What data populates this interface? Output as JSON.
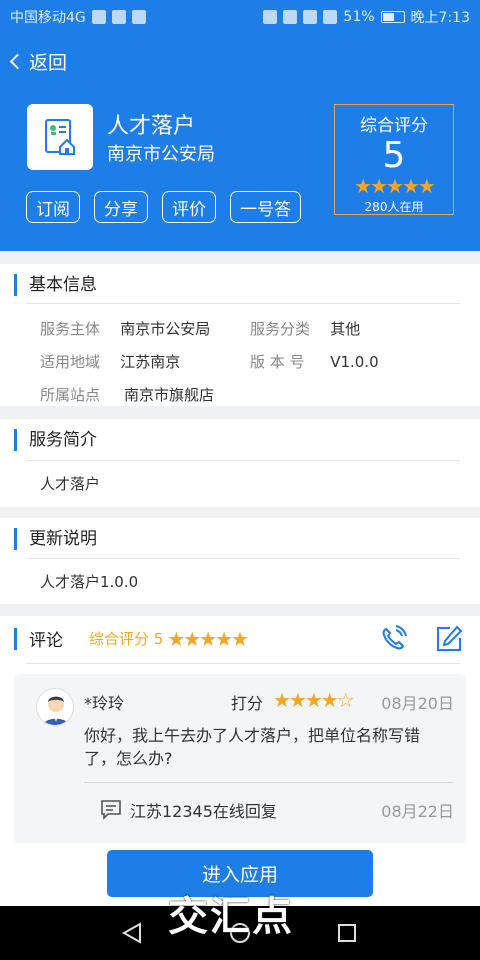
{
  "status_bar": {
    "carrier": "中国移动4G",
    "battery": "51%",
    "time": "晚上7:13"
  },
  "header": {
    "back_label": "返回",
    "app_name": "人才落户",
    "provider": "南京市公安局",
    "score_label": "综合评分",
    "score_value": "5",
    "score_stars": "★★★★★",
    "users": "280人在用",
    "buttons": [
      "订阅",
      "分享",
      "评价",
      "一号答"
    ]
  },
  "basic_info": {
    "title": "基本信息",
    "rows": [
      [
        {
          "key": "服务主体",
          "value": "南京市公安局"
        },
        {
          "key": "服务分类",
          "value": "其他"
        }
      ],
      [
        {
          "key": "适用地域",
          "value": "江苏南京"
        },
        {
          "key": "版 本 号",
          "value": "V1.0.0"
        }
      ],
      [
        {
          "key": "所属站点",
          "value": "南京市旗舰店"
        }
      ]
    ]
  },
  "service_intro": {
    "title": "服务简介",
    "text": "人才落户"
  },
  "update_notes": {
    "title": "更新说明",
    "text": "人才落户1.0.0"
  },
  "comments": {
    "title": "评论",
    "score_label": "综合评分 5",
    "stars": "★★★★★",
    "item": {
      "user": "*玲玲",
      "rate_label": "打分",
      "rating": 4,
      "stars_full": "★★★★",
      "stars_empty": "☆",
      "date": "08月20日",
      "text": "你好，我上午去办了人才落户，把单位名称写错了，怎么办?",
      "reply_name": "江苏12345在线回复",
      "reply_date": "08月22日"
    }
  },
  "bottom": {
    "enter_label": "进入应用"
  },
  "watermark": "交汇点",
  "colors": {
    "primary": "#1e7ee8",
    "star": "#f5a623",
    "score_border": "#f0a14a"
  }
}
